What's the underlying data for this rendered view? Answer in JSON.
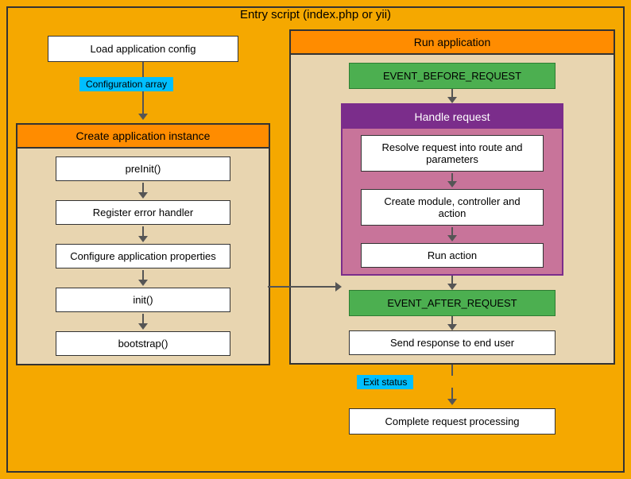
{
  "page": {
    "title": "Entry script (index.php or yii)"
  },
  "left": {
    "load_config": "Load application config",
    "config_label": "Configuration array",
    "create_app_header": "Create application instance",
    "steps": [
      "preInit()",
      "Register error handler",
      "Configure application properties",
      "init()",
      "bootstrap()"
    ]
  },
  "right": {
    "run_app_header": "Run application",
    "event_before": "EVENT_BEFORE_REQUEST",
    "handle_request_header": "Handle request",
    "handle_steps": [
      "Resolve request into route and parameters",
      "Create module, controller and action",
      "Run action"
    ],
    "event_after": "EVENT_AFTER_REQUEST",
    "send_response": "Send response to end user",
    "exit_label": "Exit status",
    "complete": "Complete request processing"
  }
}
